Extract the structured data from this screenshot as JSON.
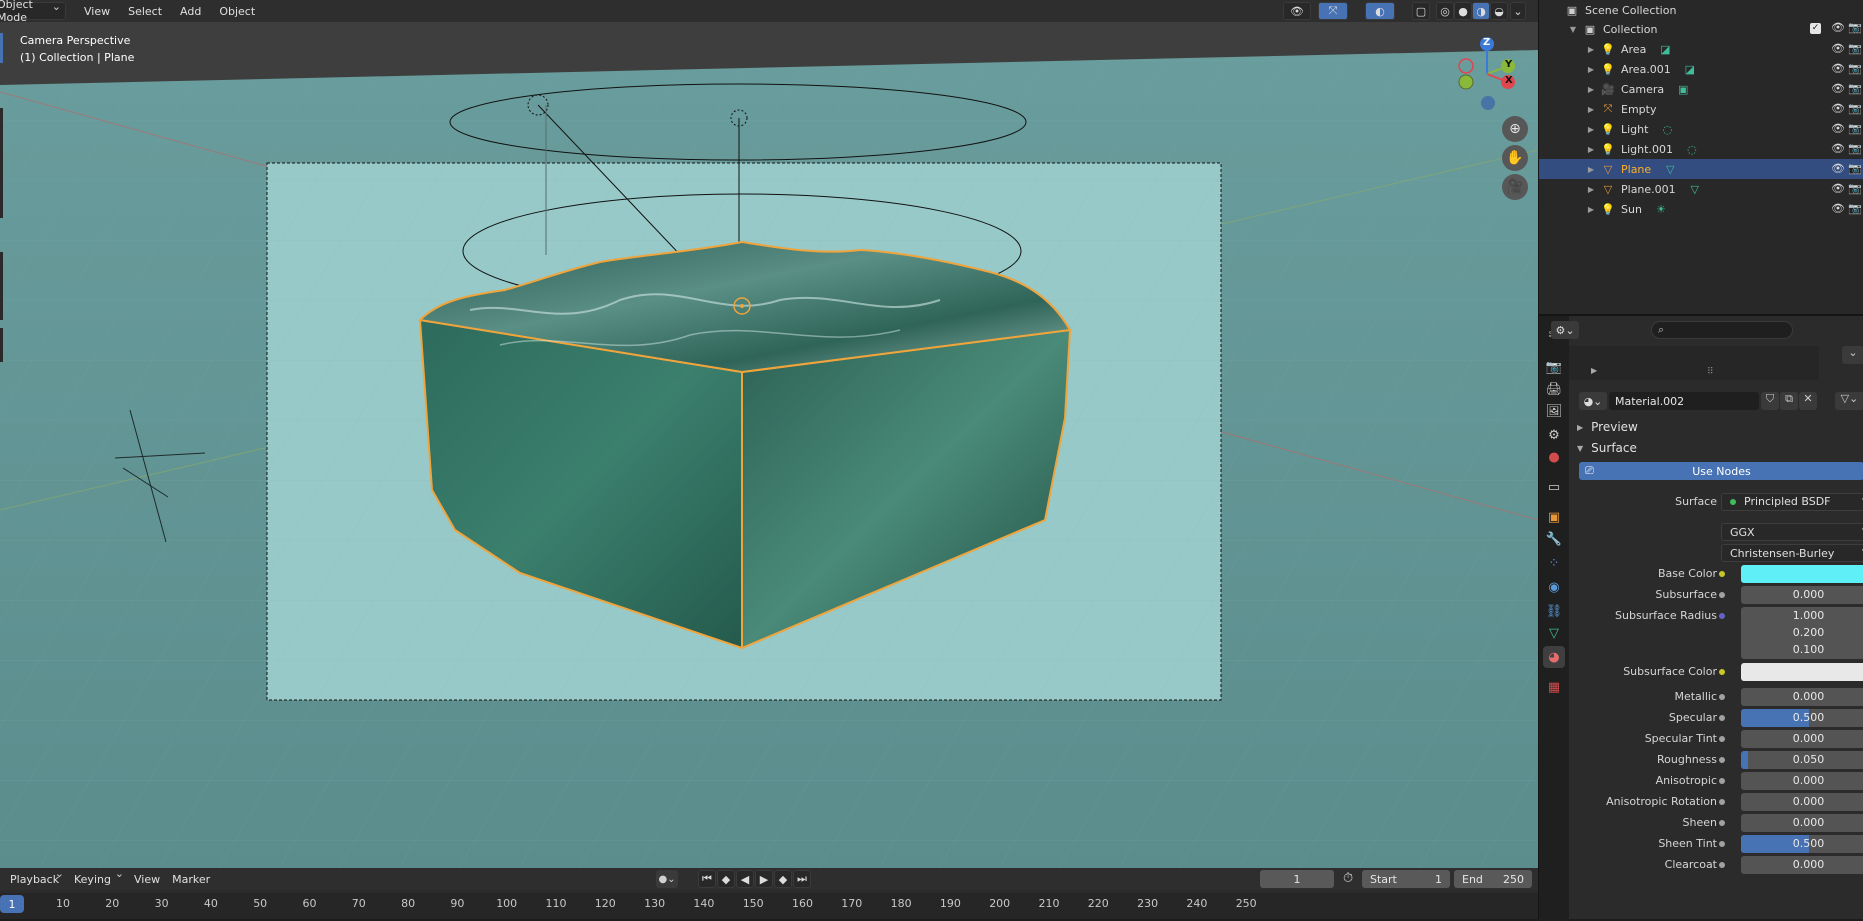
{
  "viewport": {
    "header": {
      "mode": "Object Mode",
      "menus": [
        "View",
        "Select",
        "Add",
        "Object"
      ]
    },
    "info": {
      "line1": "Camera Perspective",
      "line2": "(1) Collection | Plane"
    },
    "gizmo": {
      "x": "X",
      "y": "Y",
      "z": "Z"
    }
  },
  "timeline": {
    "menus": {
      "playback": "Playback",
      "keying": "Keying",
      "view": "View",
      "marker": "Marker"
    },
    "current_frame": "1",
    "start_label": "Start",
    "start_value": "1",
    "end_label": "End",
    "end_value": "250",
    "ruler_current": "1",
    "ruler_ticks": [
      "10",
      "20",
      "30",
      "40",
      "50",
      "60",
      "70",
      "80",
      "90",
      "100",
      "110",
      "120",
      "130",
      "140",
      "150",
      "160",
      "170",
      "180",
      "190",
      "200",
      "210",
      "220",
      "230",
      "240",
      "250"
    ]
  },
  "outliner": {
    "scene_collection": "Scene Collection",
    "collection": "Collection",
    "items": [
      {
        "name": "Area",
        "icon": "light-icon",
        "data_icon": "area-light-data-icon"
      },
      {
        "name": "Area.001",
        "icon": "light-icon",
        "data_icon": "area-light-data-icon"
      },
      {
        "name": "Camera",
        "icon": "camera-icon",
        "data_icon": "camera-data-icon"
      },
      {
        "name": "Empty",
        "icon": "empty-icon",
        "data_icon": ""
      },
      {
        "name": "Light",
        "icon": "light-icon",
        "data_icon": "point-light-data-icon"
      },
      {
        "name": "Light.001",
        "icon": "light-icon",
        "data_icon": "point-light-data-icon"
      },
      {
        "name": "Plane",
        "icon": "mesh-icon",
        "data_icon": "mesh-data-icon"
      },
      {
        "name": "Plane.001",
        "icon": "mesh-icon",
        "data_icon": "mesh-data-icon"
      },
      {
        "name": "Sun",
        "icon": "light-icon",
        "data_icon": "sun-light-data-icon"
      }
    ],
    "selected": "Plane"
  },
  "properties": {
    "search_placeholder": "",
    "material_name": "Material.002",
    "panels": {
      "preview": "Preview",
      "surface": "Surface"
    },
    "use_nodes": "Use Nodes",
    "surface_label": "Surface",
    "surface_shader": "Principled BSDF",
    "distribution": "GGX",
    "subsurface_method": "Christensen-Burley",
    "base_color_label": "Base Color",
    "base_color": "#5ff0f7",
    "subsurface_color_label": "Subsurface Color",
    "subsurface_color": "#e8e8e8",
    "subsurface_label": "Subsurface",
    "subsurface_value": "0.000",
    "subsurface_radius_label": "Subsurface Radius",
    "subsurface_radius": [
      "1.000",
      "0.200",
      "0.100"
    ],
    "fields": [
      {
        "label": "Metallic",
        "value": "0.000",
        "fill": 0
      },
      {
        "label": "Specular",
        "value": "0.500",
        "fill": 0.5
      },
      {
        "label": "Specular Tint",
        "value": "0.000",
        "fill": 0
      },
      {
        "label": "Roughness",
        "value": "0.050",
        "fill": 0.05
      },
      {
        "label": "Anisotropic",
        "value": "0.000",
        "fill": 0
      },
      {
        "label": "Anisotropic Rotation",
        "value": "0.000",
        "fill": 0
      },
      {
        "label": "Sheen",
        "value": "0.000",
        "fill": 0
      },
      {
        "label": "Sheen Tint",
        "value": "0.500",
        "fill": 0.5
      },
      {
        "label": "Clearcoat",
        "value": "0.000",
        "fill": 0
      }
    ]
  },
  "colors": {
    "accent": "#4772b3",
    "selection": "#ffaf29",
    "light_icon": "#e5973a",
    "data_icon": "#3fbd9b"
  }
}
